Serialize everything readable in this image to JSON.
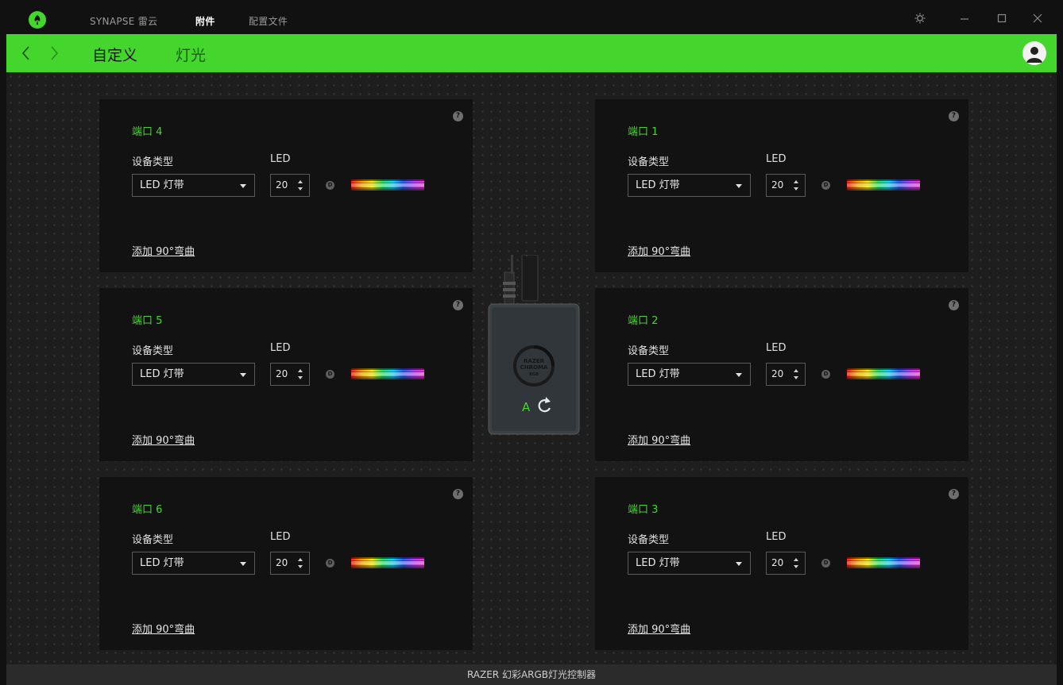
{
  "app": {
    "nav_tabs": [
      "SYNAPSE 雷云",
      "附件",
      "配置文件"
    ],
    "active_tab": 1
  },
  "header": {
    "subtabs": [
      "自定义",
      "灯光"
    ]
  },
  "ports": {
    "p4": {
      "title": "端口 4",
      "device_type_label": "设备类型",
      "led_label": "LED",
      "device_type": "LED 灯带",
      "led_count": "20",
      "d_badge": "D",
      "bend_link": "添加 90°弯曲"
    },
    "p1": {
      "title": "端口 1",
      "device_type_label": "设备类型",
      "led_label": "LED",
      "device_type": "LED 灯带",
      "led_count": "20",
      "d_badge": "D",
      "bend_link": "添加 90°弯曲"
    },
    "p5": {
      "title": "端口 5",
      "device_type_label": "设备类型",
      "led_label": "LED",
      "device_type": "LED 灯带",
      "led_count": "20",
      "d_badge": "D",
      "bend_link": "添加 90°弯曲"
    },
    "p2": {
      "title": "端口 2",
      "device_type_label": "设备类型",
      "led_label": "LED",
      "device_type": "LED 灯带",
      "led_count": "20",
      "d_badge": "D",
      "bend_link": "添加 90°弯曲"
    },
    "p6": {
      "title": "端口 6",
      "device_type_label": "设备类型",
      "led_label": "LED",
      "device_type": "LED 灯带",
      "led_count": "20",
      "d_badge": "D",
      "bend_link": "添加 90°弯曲"
    },
    "p3": {
      "title": "端口 3",
      "device_type_label": "设备类型",
      "led_label": "LED",
      "device_type": "LED 灯带",
      "led_count": "20",
      "d_badge": "D",
      "bend_link": "添加 90°弯曲"
    }
  },
  "controller": {
    "logo_lines": [
      "RAZER",
      "CHROMA",
      "RGB"
    ],
    "mode_label": "A"
  },
  "footer": {
    "device_name": "RAZER 幻彩ARGB灯光控制器"
  },
  "colors": {
    "accent": "#44d62c",
    "background": "#1e1e1e",
    "card": "#121212"
  },
  "icons": [
    "razer-logo-icon",
    "gear-icon",
    "minimize-icon",
    "maximize-icon",
    "close-icon",
    "back-arrow-icon",
    "forward-arrow-icon",
    "user-avatar-icon",
    "help-icon",
    "dropdown-caret-icon",
    "refresh-icon"
  ]
}
